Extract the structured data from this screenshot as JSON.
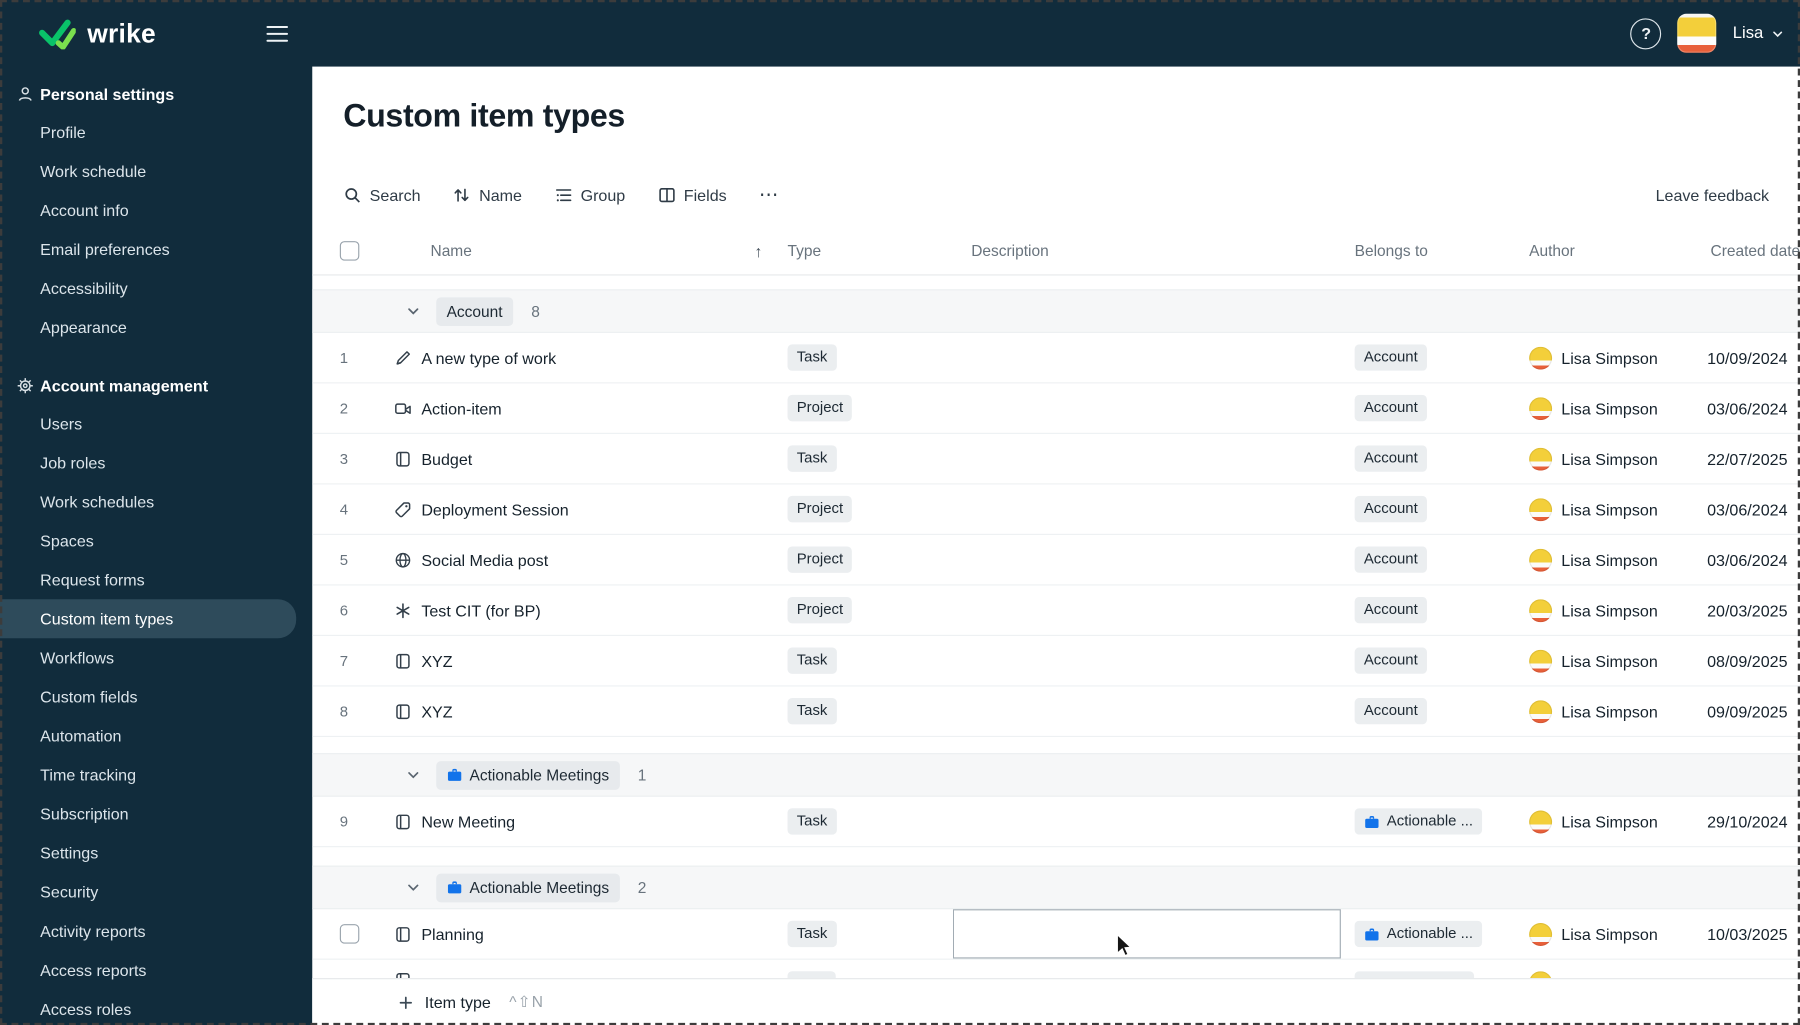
{
  "topbar": {
    "brand": "wrike",
    "help_label": "?",
    "user_name": "Lisa"
  },
  "sidebar": {
    "sections": [
      {
        "label": "Personal settings",
        "icon": "person-icon",
        "items": [
          "Profile",
          "Work schedule",
          "Account info",
          "Email preferences",
          "Accessibility",
          "Appearance"
        ]
      },
      {
        "label": "Account management",
        "icon": "gear-icon",
        "selected": "Custom item types",
        "items": [
          "Users",
          "Job roles",
          "Work schedules",
          "Spaces",
          "Request forms",
          "Custom item types",
          "Workflows",
          "Custom fields",
          "Automation",
          "Time tracking",
          "Subscription",
          "Settings",
          "Security",
          "Activity reports",
          "Access reports",
          "Access roles"
        ]
      }
    ]
  },
  "main": {
    "title": "Custom item types",
    "toolbar": {
      "search": "Search",
      "sort_by": "Name",
      "group": "Group",
      "fields": "Fields",
      "more": "⋯",
      "leave_feedback": "Leave feedback"
    },
    "table": {
      "columns": [
        "Name",
        "Type",
        "Description",
        "Belongs to",
        "Author",
        "Created date"
      ],
      "sort_indicator": "↑",
      "groups": [
        {
          "label": "Account",
          "count": "8",
          "icon": null,
          "rows": [
            {
              "num": "1",
              "icon": "pen-icon",
              "name": "A new type of work",
              "type": "Task",
              "belongs_to": "Account",
              "author": "Lisa Simpson",
              "created": "10/09/2024"
            },
            {
              "num": "2",
              "icon": "camera-icon",
              "name": "Action-item",
              "type": "Project",
              "belongs_to": "Account",
              "author": "Lisa Simpson",
              "created": "03/06/2024"
            },
            {
              "num": "3",
              "icon": "book-icon",
              "name": "Budget",
              "type": "Task",
              "belongs_to": "Account",
              "author": "Lisa Simpson",
              "created": "22/07/2025"
            },
            {
              "num": "4",
              "icon": "tag-icon",
              "name": "Deployment Session",
              "type": "Project",
              "belongs_to": "Account",
              "author": "Lisa Simpson",
              "created": "03/06/2024"
            },
            {
              "num": "5",
              "icon": "globe-icon",
              "name": "Social Media post",
              "type": "Project",
              "belongs_to": "Account",
              "author": "Lisa Simpson",
              "created": "03/06/2024"
            },
            {
              "num": "6",
              "icon": "asterisk-icon",
              "name": "Test CIT (for BP)",
              "type": "Project",
              "belongs_to": "Account",
              "author": "Lisa Simpson",
              "created": "20/03/2025"
            },
            {
              "num": "7",
              "icon": "book-icon",
              "name": "XYZ",
              "type": "Task",
              "belongs_to": "Account",
              "author": "Lisa Simpson",
              "created": "08/09/2025"
            },
            {
              "num": "8",
              "icon": "book-icon",
              "name": "XYZ",
              "type": "Task",
              "belongs_to": "Account",
              "author": "Lisa Simpson",
              "created": "09/09/2025"
            }
          ]
        },
        {
          "label": "Actionable Meetings",
          "count": "1",
          "icon": "briefcase-icon",
          "rows": [
            {
              "num": "9",
              "icon": "book-icon",
              "name": "New Meeting",
              "type": "Task",
              "belongs_to": "Actionable ...",
              "belongs_icon": "briefcase-icon",
              "author": "Lisa Simpson",
              "created": "29/10/2024"
            }
          ]
        },
        {
          "label": "Actionable Meetings",
          "count": "2",
          "icon": "briefcase-icon",
          "rows": [
            {
              "num": "",
              "checkbox": true,
              "description_cell_focused": true,
              "icon": "book-icon",
              "name": "Planning",
              "type": "Task",
              "belongs_to": "Actionable ...",
              "belongs_icon": "briefcase-icon",
              "author": "Lisa Simpson",
              "created": "10/03/2025"
            }
          ]
        }
      ]
    },
    "footer": {
      "add_button": "Item type",
      "shortcut": "^⇧N"
    }
  }
}
